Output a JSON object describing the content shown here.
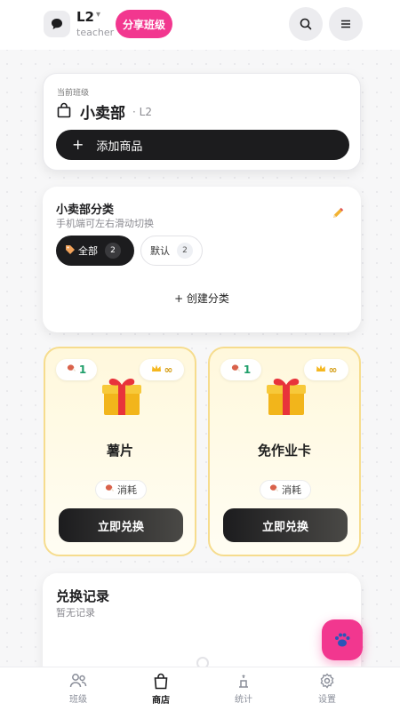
{
  "header": {
    "class_name": "L2",
    "role": "teacher",
    "share_label": "分享班级",
    "icons": [
      "chat-icon",
      "search-icon",
      "menu-icon"
    ]
  },
  "current_class": {
    "label": "当前班级",
    "name": "小卖部",
    "level": "· L2",
    "add_label": "添加商品"
  },
  "categories": {
    "title": "小卖部分类",
    "subtitle": "手机端可左右滑动切换",
    "chips": [
      {
        "label": "全部",
        "count": "2",
        "selected": true
      },
      {
        "label": "默认",
        "count": "2",
        "selected": false
      }
    ],
    "create_label": "+ 创建分类"
  },
  "products": [
    {
      "name": "薯片",
      "cost": "1",
      "stock": "∞",
      "tag": "消耗",
      "action": "立即兑换"
    },
    {
      "name": "免作业卡",
      "cost": "1",
      "stock": "∞",
      "tag": "消耗",
      "action": "立即兑换"
    }
  ],
  "records": {
    "title": "兑换记录",
    "empty_text": "暂无记录"
  },
  "nav": [
    {
      "label": "班级",
      "active": false
    },
    {
      "label": "商店",
      "active": true
    },
    {
      "label": "统计",
      "active": false
    },
    {
      "label": "设置",
      "active": false
    }
  ],
  "colors": {
    "accent": "#f2378f",
    "dark": "#1c1c1e",
    "card_gold": "#fff8dc",
    "cost_green": "#1e9e6a"
  }
}
